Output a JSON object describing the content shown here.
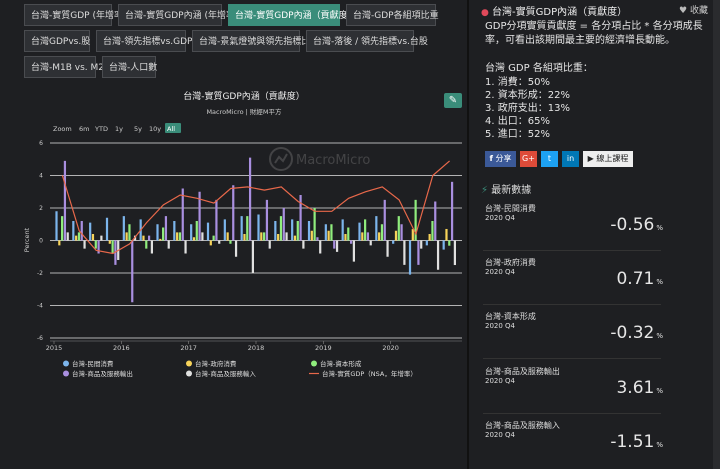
{
  "tabs": [
    {
      "label": "台灣-實質GDP (年增率)"
    },
    {
      "label": "台灣-實質GDP內涵 (年增率)"
    },
    {
      "label": "台灣-實質GDP內涵（貢獻度）"
    },
    {
      "label": "台灣-GDP各組項比重"
    },
    {
      "label": "台灣GDPvs.股"
    },
    {
      "label": "台灣-領先指標vs.GDP"
    },
    {
      "label": "台灣-景氣燈號與領先指標比值"
    },
    {
      "label": "台灣-落後 / 領先指標vs.台股"
    },
    {
      "label": "台灣-M1B vs. M2"
    },
    {
      "label": "台灣-人口數"
    }
  ],
  "zoom": {
    "label": "Zoom",
    "options": [
      "6m",
      "YTD",
      "1y",
      "5y",
      "10y",
      "All"
    ],
    "active": "All"
  },
  "watermark": "MacroMicro",
  "colors": {
    "household": "#7cb5ec",
    "government": "#f7d35a",
    "capital": "#90ed7d",
    "exports": "#a98fe0",
    "imports": "#e0e0e0",
    "gdp": "#e8684a",
    "accent": "#3a8d7a",
    "grid": "#e6e6e6"
  },
  "chart_data": {
    "type": "bar",
    "title": "台灣-實質GDP內涵（貢獻度）",
    "subtitle": "MacroMicro | 財經M平方",
    "ylabel": "Percent",
    "ylim": [
      -6,
      6
    ],
    "yticks": [
      "6",
      "4",
      "2",
      "0",
      "-2",
      "-4",
      "-6"
    ],
    "xtick_labels": [
      "2015",
      "2016",
      "2017",
      "2018",
      "2019",
      "2020"
    ],
    "quarters": [
      "2015Q1",
      "2015Q2",
      "2015Q3",
      "2015Q4",
      "2016Q1",
      "2016Q2",
      "2016Q3",
      "2016Q4",
      "2017Q1",
      "2017Q2",
      "2017Q3",
      "2017Q4",
      "2018Q1",
      "2018Q2",
      "2018Q3",
      "2018Q4",
      "2019Q1",
      "2019Q2",
      "2019Q3",
      "2019Q4",
      "2020Q1",
      "2020Q2",
      "2020Q3",
      "2020Q4"
    ],
    "series": [
      {
        "name": "台灣-民間消費",
        "values": [
          1.8,
          1.2,
          1.1,
          1.4,
          1.5,
          1.3,
          1.0,
          1.2,
          1.0,
          1.1,
          1.3,
          1.5,
          1.6,
          1.2,
          1.3,
          1.2,
          1.0,
          1.3,
          1.1,
          1.5,
          -0.2,
          -2.1,
          -0.3,
          -0.56
        ]
      },
      {
        "name": "台灣-政府消費",
        "values": [
          -0.3,
          0.3,
          0.4,
          -0.2,
          0.5,
          0.3,
          0.1,
          0.5,
          0.2,
          -0.3,
          0.5,
          0.4,
          0.5,
          0.4,
          0.3,
          0.6,
          0.6,
          0.4,
          0.5,
          0.5,
          0.6,
          0.7,
          0.4,
          0.71
        ]
      },
      {
        "name": "台灣-資本形成",
        "values": [
          1.5,
          0.5,
          -0.5,
          -0.8,
          1.0,
          -0.5,
          0.8,
          0.5,
          1.2,
          0.3,
          -0.2,
          1.5,
          0.5,
          1.5,
          1.2,
          2.0,
          1.0,
          0.8,
          1.3,
          1.0,
          1.5,
          2.5,
          1.2,
          -0.32
        ]
      },
      {
        "name": "台灣-商品及服務輸出",
        "values": [
          4.9,
          1.2,
          -0.8,
          -1.5,
          -3.8,
          0.3,
          1.5,
          3.2,
          3.0,
          2.5,
          3.4,
          5.1,
          2.5,
          2.0,
          2.8,
          0.2,
          -0.5,
          -0.2,
          0.5,
          2.5,
          1.0,
          -1.5,
          2.4,
          3.61
        ]
      },
      {
        "name": "台灣-商品及服務輸入",
        "values": [
          0.5,
          -0.5,
          0.3,
          -1.2,
          0.3,
          -0.8,
          -0.5,
          -0.8,
          0.5,
          -0.2,
          -1.0,
          -2.0,
          -0.5,
          0.5,
          -0.5,
          -0.8,
          -0.7,
          -1.3,
          -0.3,
          -1.0,
          -1.5,
          -0.5,
          -1.8,
          -1.51
        ]
      }
    ],
    "line": {
      "name": "台灣-實質GDP（NSA，年增率）",
      "values": [
        4.0,
        0.6,
        -0.6,
        -0.8,
        -0.2,
        1.1,
        2.2,
        2.8,
        2.6,
        2.3,
        3.2,
        3.3,
        3.1,
        3.3,
        2.4,
        1.8,
        1.8,
        2.6,
        3.0,
        3.3,
        2.5,
        0.4,
        4.0,
        4.9
      ]
    }
  },
  "right": {
    "title": "台灣-實質GDP內涵（貢獻度）",
    "fav": "收藏",
    "desc": "GDP分項實質貢獻度 = 各分項占比 * 各分項成長率，可看出該期間最主要的經濟增長動能。",
    "list_title": "台灣 GDP 各組項比重：",
    "list": [
      "1. 消費：50%",
      "2. 資本形成：22%",
      "3. 政府支出：13%",
      "4. 出口：65%",
      "5. 進口：52%"
    ],
    "share_fb": "分享",
    "share_gplus": "G+",
    "share_tw": "t",
    "share_li": "in",
    "share_course": "線上課程",
    "latest": "最新數據",
    "cards": [
      {
        "name": "台灣-民間消費",
        "date": "2020 Q4",
        "value": "-0.56",
        "unit": "%"
      },
      {
        "name": "台灣-政府消費",
        "date": "2020 Q4",
        "value": "0.71",
        "unit": "%"
      },
      {
        "name": "台灣-資本形成",
        "date": "2020 Q4",
        "value": "-0.32",
        "unit": "%"
      },
      {
        "name": "台灣-商品及服務輸出",
        "date": "2020 Q4",
        "value": "3.61",
        "unit": "%"
      },
      {
        "name": "台灣-商品及服務輸入",
        "date": "2020 Q4",
        "value": "-1.51",
        "unit": "%"
      }
    ]
  }
}
